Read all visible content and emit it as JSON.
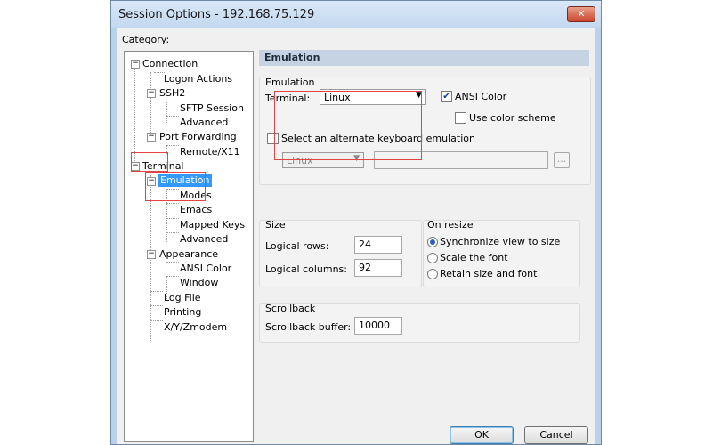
{
  "window": {
    "title": "Session Options - 192.168.75.129",
    "close_glyph": "✕"
  },
  "category_label": "Category:",
  "tree": {
    "connection": "Connection",
    "logon_actions": "Logon Actions",
    "ssh2": "SSH2",
    "sftp_session": "SFTP Session",
    "ssh2_advanced": "Advanced",
    "port_forwarding": "Port Forwarding",
    "remote_x11": "Remote/X11",
    "terminal": "Terminal",
    "emulation": "Emulation",
    "modes": "Modes",
    "emacs": "Emacs",
    "mapped_keys": "Mapped Keys",
    "emulation_advanced": "Advanced",
    "appearance": "Appearance",
    "ansi_color": "ANSI Color",
    "window": "Window",
    "log_file": "Log File",
    "printing": "Printing",
    "xyzmodem": "X/Y/Zmodem"
  },
  "panel": {
    "header": "Emulation",
    "emulation_group": {
      "title": "Emulation",
      "terminal_label": "Terminal:",
      "terminal_value": "Linux",
      "ansi_color_label": "ANSI Color",
      "ansi_color_checked": true,
      "use_color_scheme_label": "Use color scheme",
      "use_color_scheme_checked": false,
      "alt_keyboard_label": "Select an alternate keyboard emulation",
      "alt_keyboard_checked": false,
      "alt_keyboard_value": "Linux",
      "browse_label": "..."
    },
    "size_group": {
      "title": "Size",
      "rows_label": "Logical rows:",
      "rows_value": "24",
      "columns_label": "Logical columns:",
      "columns_value": "92"
    },
    "resize_group": {
      "title": "On resize",
      "options": [
        "Synchronize view to size",
        "Scale the font",
        "Retain size and font"
      ],
      "selected": "Synchronize view to size"
    },
    "scrollback_group": {
      "title": "Scrollback",
      "buffer_label": "Scrollback buffer:",
      "buffer_value": "10000"
    }
  },
  "buttons": {
    "ok": "OK",
    "cancel": "Cancel"
  },
  "colors": {
    "selection": "#3399ff",
    "highlight_box": "#e34343",
    "header_band": "#c5d3e3"
  }
}
